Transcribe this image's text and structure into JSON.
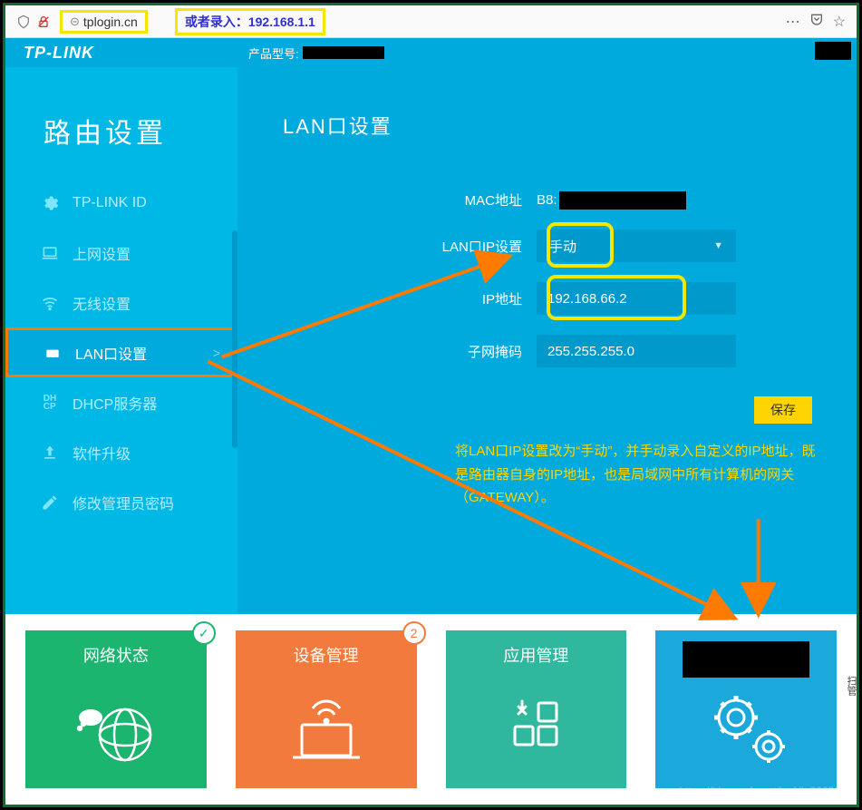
{
  "browser": {
    "url": "tplogin.cn",
    "alt_label": "或者录入：",
    "alt_ip": "192.168.1.1"
  },
  "topbar": {
    "brand": "TP-LINK",
    "model_label": "产品型号:"
  },
  "sidebar": {
    "title": "路由设置",
    "items": [
      {
        "label": "TP-LINK ID"
      },
      {
        "label": "上网设置"
      },
      {
        "label": "无线设置"
      },
      {
        "label": "LAN口设置"
      },
      {
        "label": "DHCP服务器"
      },
      {
        "label": "软件升级"
      },
      {
        "label": "修改管理员密码"
      }
    ]
  },
  "page": {
    "title": "LAN口设置",
    "mac_label": "MAC地址",
    "mac_prefix": "B8:",
    "lan_ip_mode_label": "LAN口IP设置",
    "lan_ip_mode_value": "手动",
    "ip_label": "IP地址",
    "ip_value": "192.168.66.2",
    "mask_label": "子网掩码",
    "mask_value": "255.255.255.0",
    "save": "保存",
    "note": "将LAN口IP设置改为“手动”，并手动录入自定义的IP地址，既是路由器自身的IP地址，也是局域网中所有计算机的网关（GATEWAY）。"
  },
  "tiles": [
    {
      "title": "网络状态",
      "badge": "✓"
    },
    {
      "title": "设备管理",
      "badge": "2"
    },
    {
      "title": "应用管理",
      "badge": ""
    },
    {
      "title": "",
      "badge": ""
    }
  ],
  "watermark": "https://blog.csdn.net/jackliu20091",
  "side_text": "扫管"
}
